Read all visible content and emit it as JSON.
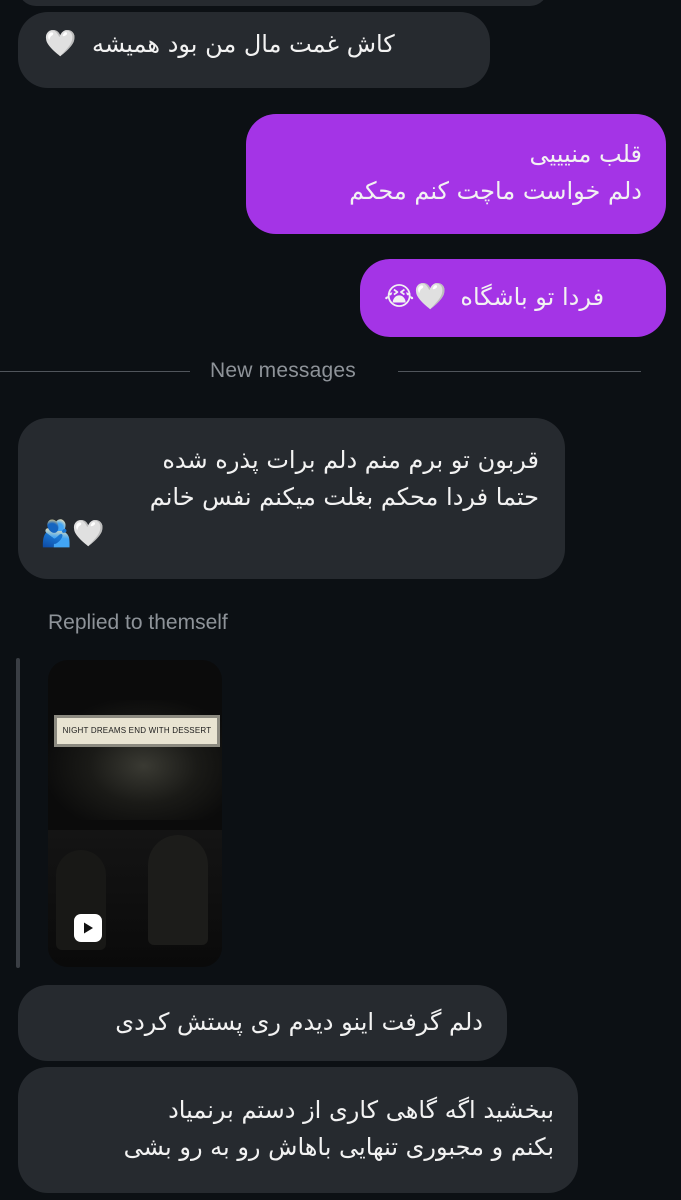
{
  "messages": {
    "m1": {
      "lines": [
        "کاش غمت مال من بود همیشه"
      ],
      "emoji": "🤍"
    },
    "m2": {
      "lines": [
        "قلب منیییی",
        "دلم خواست ماچت کنم محکم"
      ]
    },
    "m3": {
      "text": "فردا تو باشگاه",
      "emoji": "😭🤍"
    },
    "m4": {
      "lines": [
        "قربون تو برم منم دلم برات پذره شده",
        "حتما فردا محکم بغلت میکنم نفس خانم"
      ],
      "emoji": "🫂🤍"
    },
    "m5": {
      "lines": [
        "دلم گرفت اینو دیدم ری پستش کردی"
      ]
    },
    "m6": {
      "lines": [
        "ببخشید اگه گاهی کاری از دستم برنمیاد",
        "بکنم و مجبوری تنهایی باهاش رو به رو بشی"
      ]
    }
  },
  "divider": {
    "label": "New messages"
  },
  "reply": {
    "label": "Replied to themself",
    "video": {
      "sign_text": "NIGHT DREAMS END WITH DESSERT",
      "icon": "play-icon"
    }
  },
  "colors": {
    "background": "#0c1014",
    "received_bubble": "#262a2f",
    "sent_bubble": "#a434e6"
  }
}
